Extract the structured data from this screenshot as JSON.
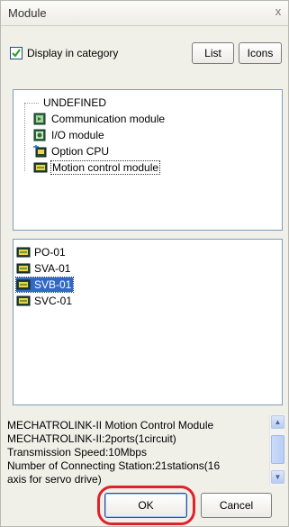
{
  "window": {
    "title": "Module",
    "close_glyph": "x"
  },
  "display_in_category": {
    "label": "Display in category",
    "checked": true
  },
  "view_buttons": {
    "list": "List",
    "icons": "Icons"
  },
  "category_tree": {
    "items": [
      {
        "label": "UNDEFINED",
        "icon": "none"
      },
      {
        "label": "Communication module",
        "icon": "communication-module-icon"
      },
      {
        "label": "I/O module",
        "icon": "io-module-icon"
      },
      {
        "label": "Option CPU",
        "icon": "option-cpu-icon"
      },
      {
        "label": "Motion control module",
        "icon": "motion-module-icon",
        "focused": true
      }
    ]
  },
  "module_list": {
    "items": [
      {
        "label": "PO-01",
        "selected": false
      },
      {
        "label": "SVA-01",
        "selected": false
      },
      {
        "label": "SVB-01",
        "selected": true
      },
      {
        "label": "SVC-01",
        "selected": false
      }
    ]
  },
  "description": {
    "lines": [
      "MECHATROLINK-II Motion Control Module",
      "MECHATROLINK-II:2ports(1circuit)",
      "Transmission Speed:10Mbps",
      "Number of Connecting Station:21stations(16",
      "axis for servo drive)"
    ]
  },
  "footer": {
    "ok": "OK",
    "cancel": "Cancel"
  },
  "colors": {
    "selection": "#316ac5",
    "highlight_ring": "#e0222b",
    "panel_border": "#7f9db9"
  }
}
